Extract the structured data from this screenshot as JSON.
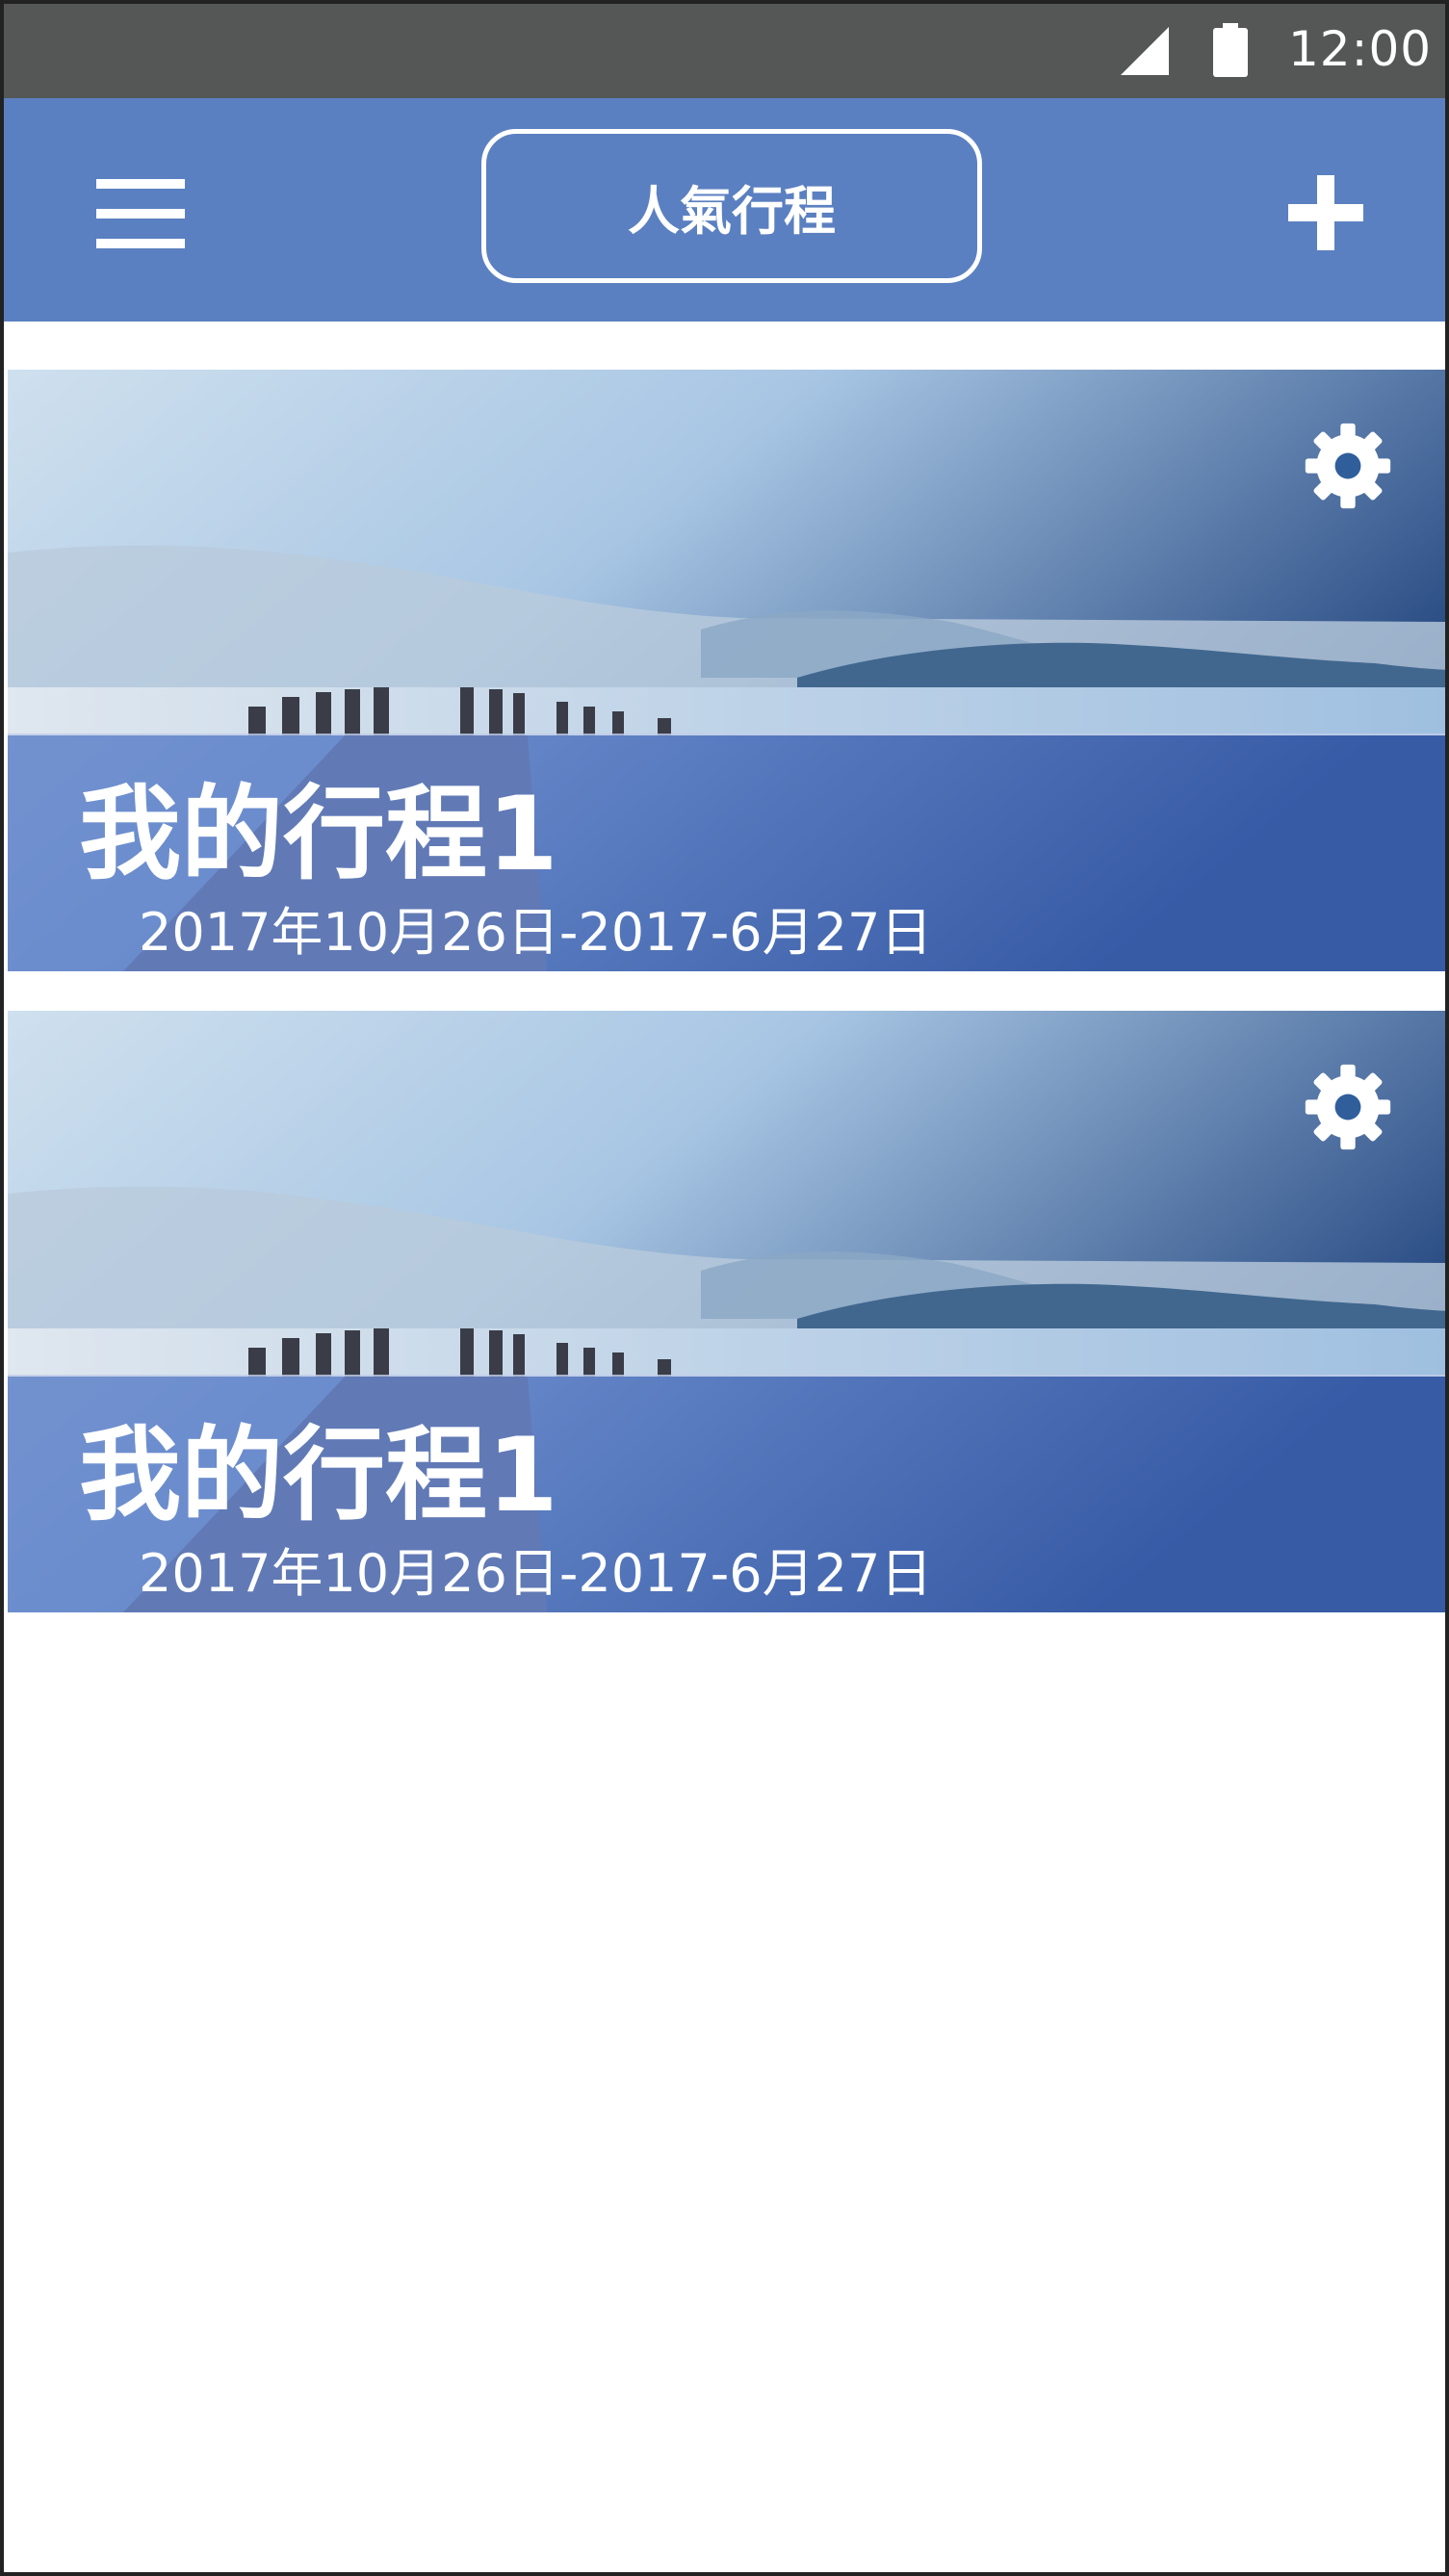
{
  "status_bar": {
    "time": "12:00",
    "icons": [
      "cellular-signal-icon",
      "battery-icon"
    ]
  },
  "app_bar": {
    "menu_icon": "hamburger-menu-icon",
    "title": "人氣行程",
    "add_icon": "plus-icon"
  },
  "trips": [
    {
      "title": "我的行程1",
      "dates": "2017年10月26日-2017-6月27日",
      "settings_icon": "gear-icon"
    },
    {
      "title": "我的行程1",
      "dates": "2017年10月26日-2017-6月27日",
      "settings_icon": "gear-icon"
    }
  ],
  "colors": {
    "status_bar": "#555756",
    "app_bar": "#5b80c1",
    "caption_overlay": "#4669be",
    "text": "#ffffff"
  }
}
